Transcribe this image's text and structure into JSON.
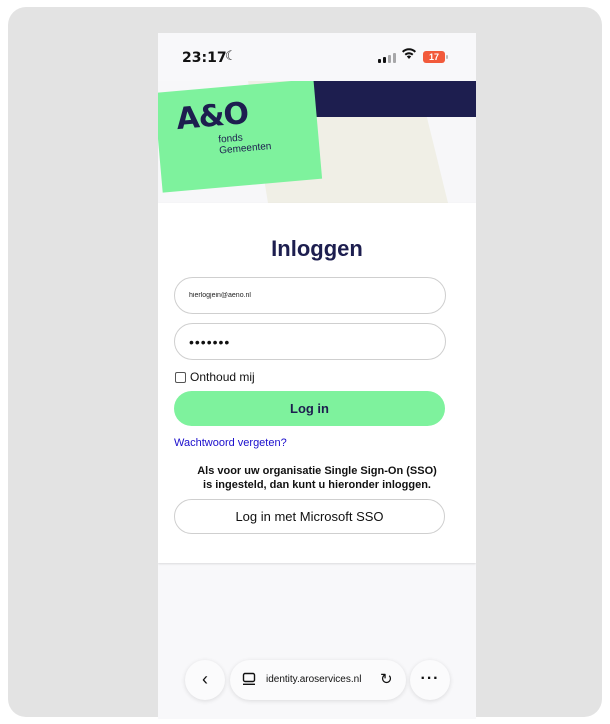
{
  "status_bar": {
    "time": "23:17",
    "battery": "17"
  },
  "brand": {
    "logo": "A&O",
    "subtitle_line1": "fonds",
    "subtitle_line2": "Gemeenten",
    "colors": {
      "navy": "#1d1e4f",
      "green": "#7ef29d",
      "beige": "#f0efe6"
    }
  },
  "login": {
    "title": "Inloggen",
    "email_value": "hierlogjein@aeno.nl",
    "password_value": "•••••••",
    "remember_label": "Onthoud mij",
    "remember_checked": false,
    "login_button": "Log in",
    "forgot_link": "Wachtwoord vergeten?",
    "sso_text_line1": "Als voor uw organisatie Single Sign-On (SSO)",
    "sso_text_line2": "is ingesteld, dan kunt u hieronder inloggen.",
    "sso_button": "Log in met Microsoft SSO"
  },
  "browser": {
    "url": "identity.aroservices.nl",
    "back_icon": "chevron-left-icon",
    "reload_icon": "reload-icon",
    "more_icon": "more-icon",
    "back_glyph": "‹",
    "more_glyph": "···",
    "reload_glyph": "↻"
  }
}
